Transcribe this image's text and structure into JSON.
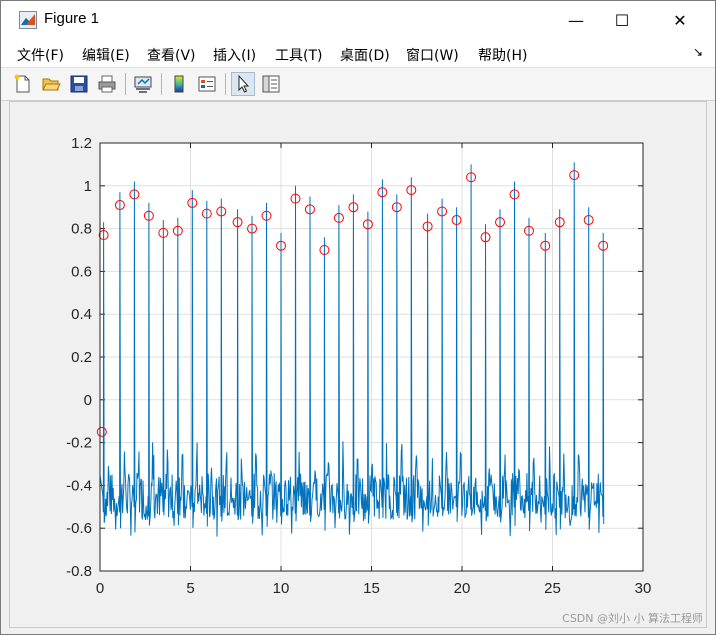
{
  "window": {
    "title": "Figure 1",
    "minimize_glyph": "—",
    "maximize_glyph": "☐",
    "close_glyph": "✕"
  },
  "menu": {
    "items": [
      "文件(F)",
      "编辑(E)",
      "查看(V)",
      "插入(I)",
      "工具(T)",
      "桌面(D)",
      "窗口(W)",
      "帮助(H)"
    ],
    "overflow_glyph": "↘"
  },
  "toolbar": {
    "buttons": [
      "new-figure-icon",
      "open-file-icon",
      "save-icon",
      "print-icon",
      "link-plot-icon",
      "colorbar-icon",
      "legend-icon",
      "pointer-edit-icon",
      "property-inspector-icon"
    ]
  },
  "watermark": "CSDN @刘小 小 算法工程师",
  "colors": {
    "line": "#0072bd",
    "markers": "#ff0000",
    "grid": "#dfdfdf"
  },
  "chart_data": {
    "type": "line",
    "xlim": [
      0,
      30
    ],
    "ylim": [
      -0.8,
      1.2
    ],
    "xticks": [
      "0",
      "5",
      "10",
      "15",
      "20",
      "25",
      "30"
    ],
    "yticks": [
      "-0.8",
      "-0.6",
      "-0.4",
      "-0.2",
      "0",
      "0.2",
      "0.4",
      "0.6",
      "0.8",
      "1",
      "1.2"
    ],
    "grid": true,
    "series": [
      {
        "type": "line",
        "baseline_min": -0.65,
        "baseline_max": -0.15
      },
      {
        "type": "scatter",
        "marker": "circle",
        "x": [
          0.1,
          0.2,
          1.1,
          1.9,
          2.7,
          3.5,
          4.3,
          5.1,
          5.9,
          6.7,
          7.6,
          8.4,
          9.2,
          10.0,
          10.8,
          11.6,
          12.4,
          13.2,
          14.0,
          14.8,
          15.6,
          16.4,
          17.2,
          18.1,
          18.9,
          19.7,
          20.5,
          21.3,
          22.1,
          22.9,
          23.7,
          24.6,
          25.4,
          26.2,
          27.0,
          27.8
        ],
        "y": [
          -0.15,
          0.77,
          0.91,
          0.96,
          0.86,
          0.78,
          0.79,
          0.92,
          0.87,
          0.88,
          0.83,
          0.8,
          0.86,
          0.72,
          0.94,
          0.89,
          0.7,
          0.85,
          0.9,
          0.82,
          0.97,
          0.9,
          0.98,
          0.81,
          0.88,
          0.84,
          1.04,
          0.76,
          0.83,
          0.96,
          0.79,
          0.72,
          0.83,
          1.05,
          0.84,
          0.72
        ]
      }
    ]
  }
}
